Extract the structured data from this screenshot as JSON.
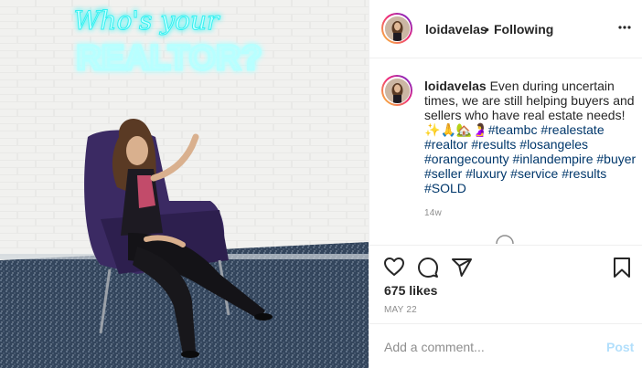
{
  "header": {
    "username": "loidavelas",
    "separator": "•",
    "follow_status": "Following",
    "more_icon": "more-horizontal-icon"
  },
  "media": {
    "neon_line1": "Who's your",
    "neon_line2": "REALTOR?",
    "neon_color": "#35f0f0"
  },
  "caption": {
    "username": "loidavelas",
    "text": "Even during uncertain times, we are still helping buyers and sellers who have real estate needs!",
    "emojis": [
      "✨",
      "🙏",
      "🏡",
      "🤰"
    ],
    "hashtags": [
      "#teambc",
      "#realestate",
      "#realtor",
      "#results",
      "#losangeles",
      "#orangecounty",
      "#inlandempire",
      "#buyer",
      "#seller",
      "#luxury",
      "#service",
      "#results",
      "#SOLD"
    ],
    "age": "14w"
  },
  "actions": {
    "like_icon": "heart-icon",
    "comment_icon": "comment-icon",
    "share_icon": "share-icon",
    "save_icon": "bookmark-icon"
  },
  "likes": "675 likes",
  "date": "MAY 22",
  "comment_box": {
    "placeholder": "Add a comment...",
    "post_label": "Post"
  },
  "colors": {
    "text": "#262626",
    "secondary": "#8e8e8e",
    "hashtag": "#00376b",
    "post_disabled": "#b2dffc",
    "border": "#efefef"
  }
}
